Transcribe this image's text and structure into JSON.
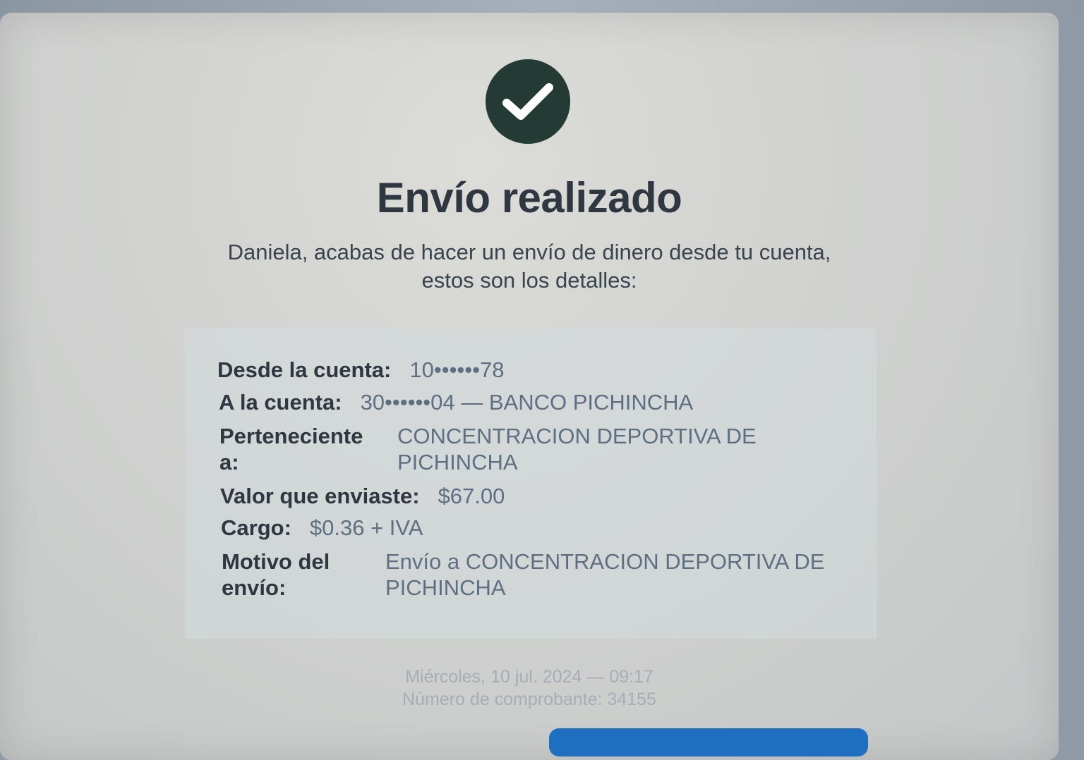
{
  "header": {
    "title": "Envío realizado",
    "subtitle": "Daniela, acabas de hacer un envío de dinero desde tu cuenta, estos son los detalles:"
  },
  "details": {
    "from_label": "Desde la cuenta:",
    "from_value": "10••••••78",
    "to_label": "A la cuenta:",
    "to_value": "30••••••04 — BANCO PICHINCHA",
    "owner_label": "Perteneciente a:",
    "owner_value": "CONCENTRACION DEPORTIVA DE PICHINCHA",
    "amount_label": "Valor que enviaste:",
    "amount_value": "$67.00",
    "fee_label": "Cargo:",
    "fee_value": "$0.36 + IVA",
    "reason_label": "Motivo del envío:",
    "reason_value": "Envío a CONCENTRACION DEPORTIVA DE PICHINCHA"
  },
  "footer": {
    "datetime": "Miércoles, 10 jul. 2024 — 09:17",
    "receipt": "Número de comprobante: 34155"
  },
  "icons": {
    "success": "check-circle-icon"
  },
  "colors": {
    "success_circle": "#233b34",
    "primary_button": "#1e6fc0"
  }
}
